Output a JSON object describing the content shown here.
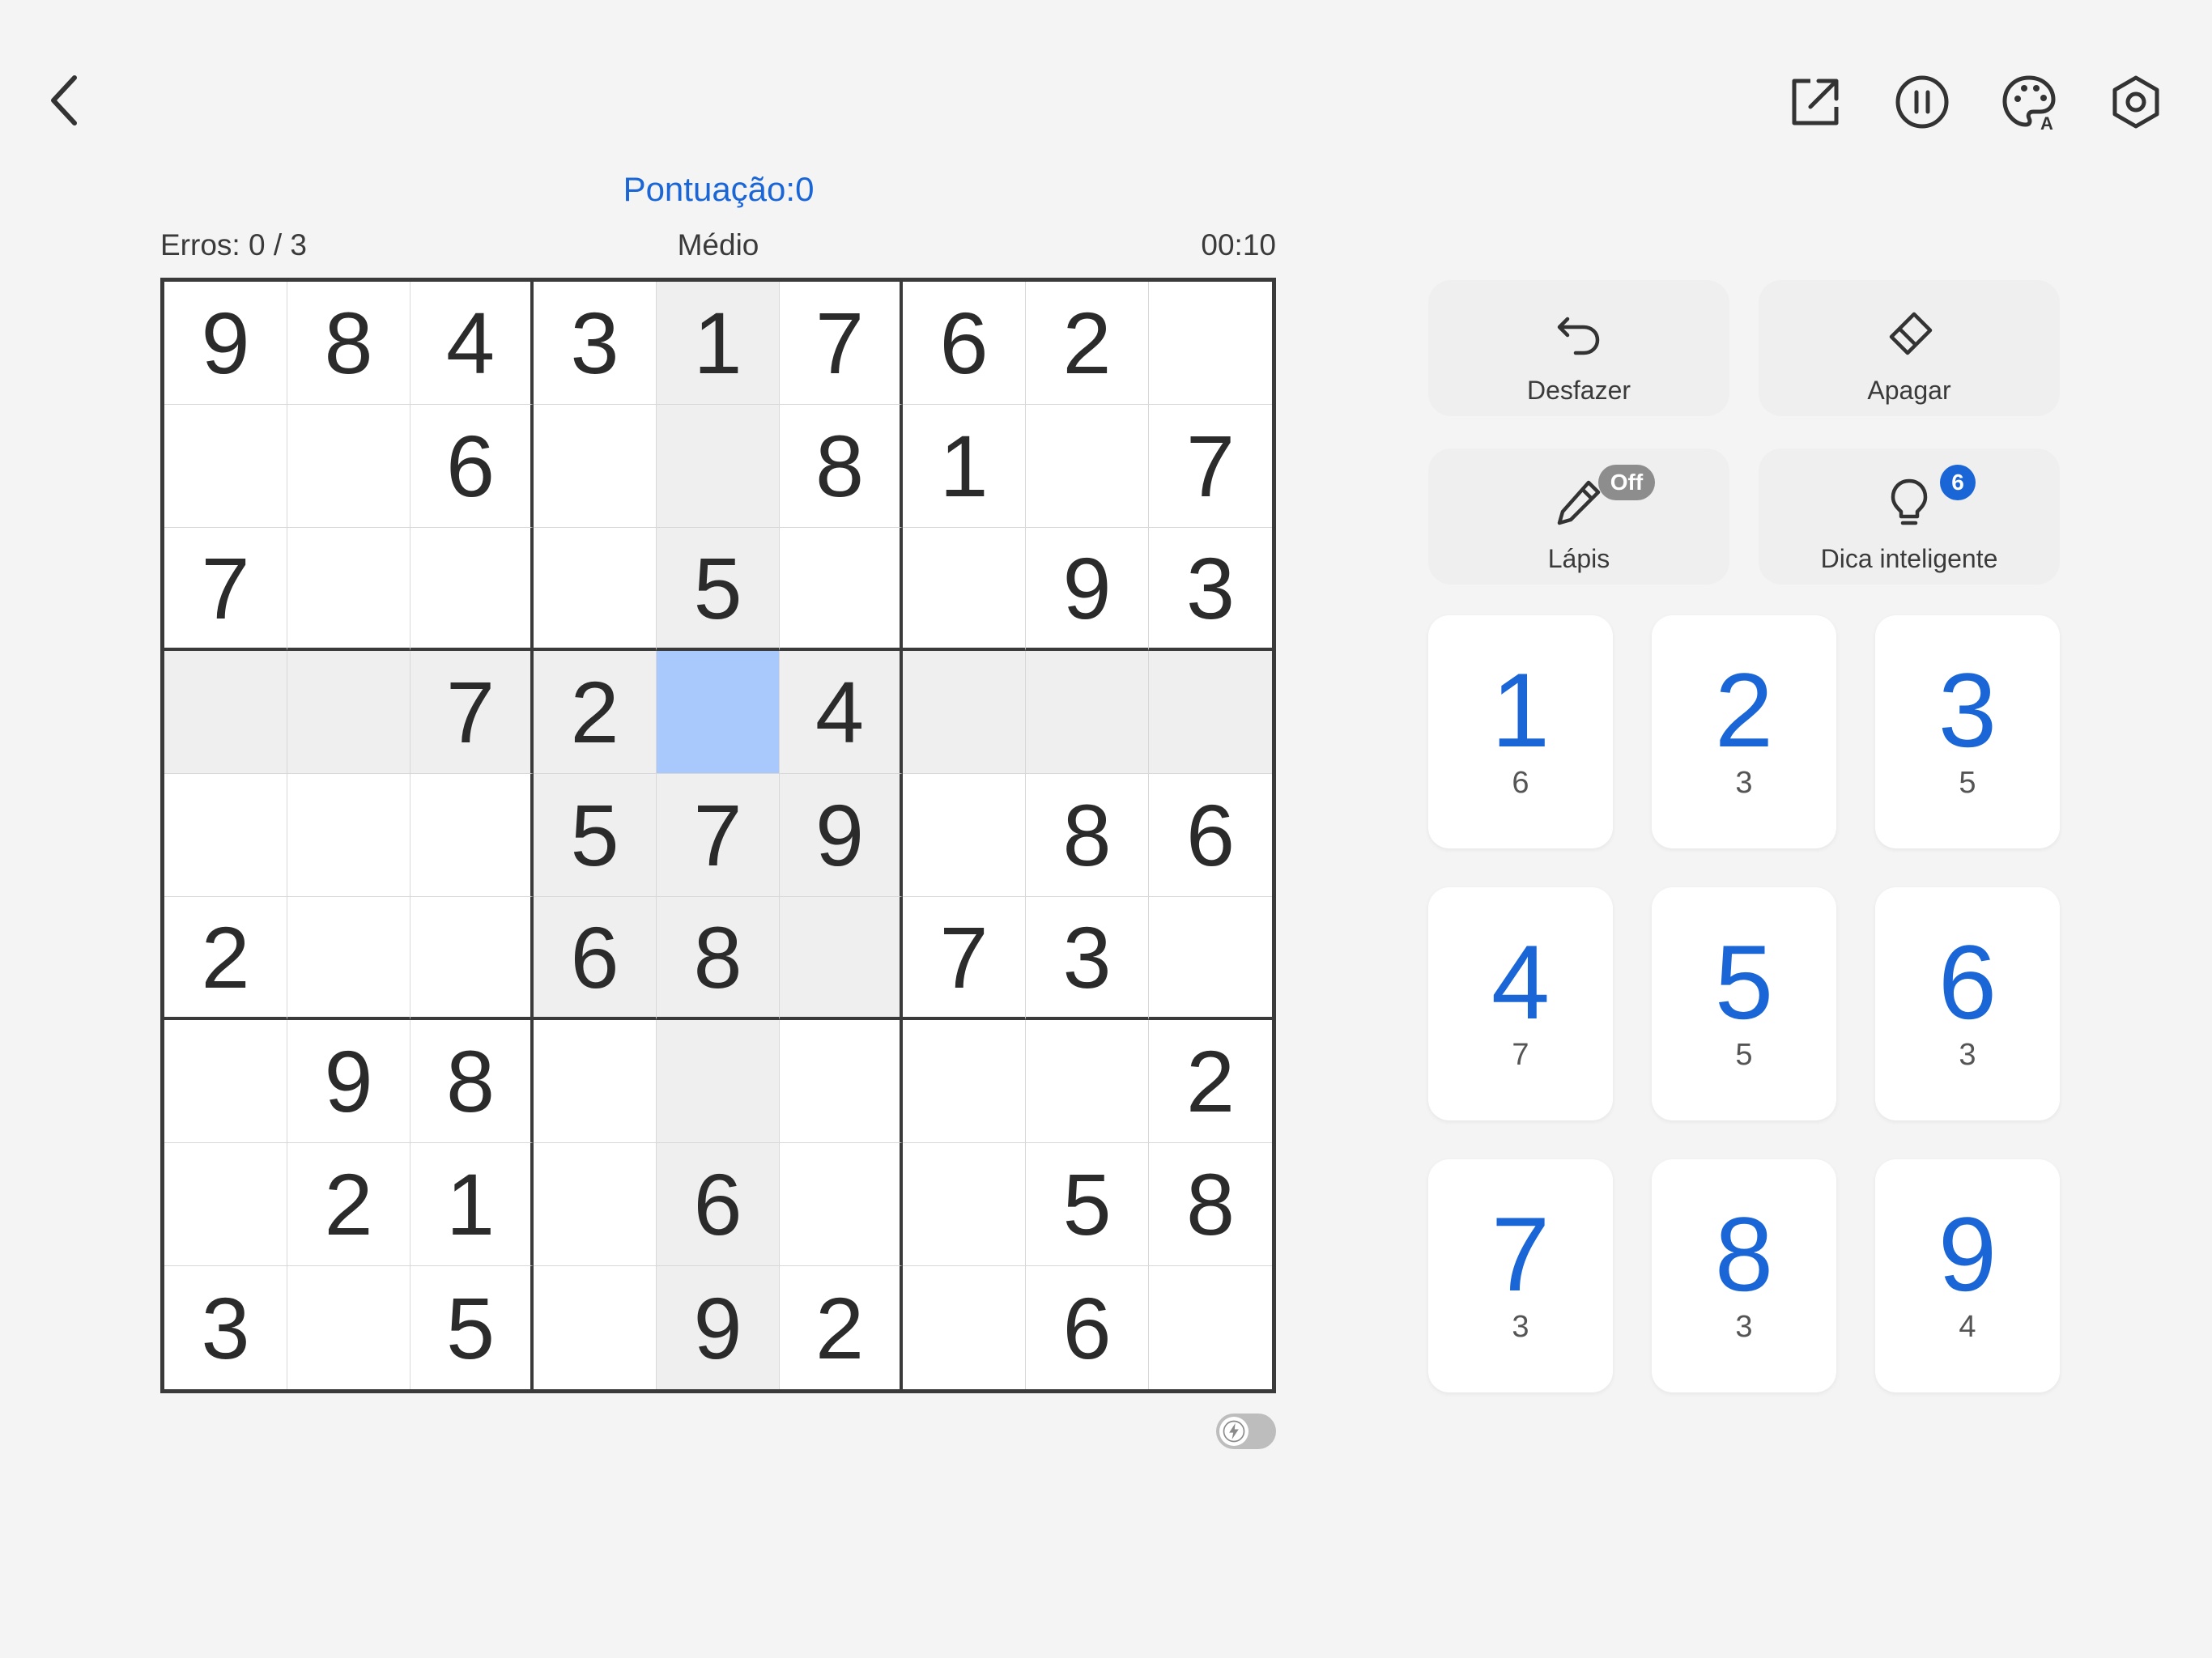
{
  "header": {
    "score_label": "Pontuação:0",
    "errors_label": "Erros: 0 / 3",
    "difficulty": "Médio",
    "timer": "00:10",
    "icons": [
      "back-icon",
      "share-icon",
      "pause-icon",
      "theme-palette-icon",
      "settings-icon"
    ]
  },
  "board": {
    "selected": [
      3,
      4
    ],
    "rows": [
      [
        "9",
        "8",
        "4",
        "3",
        "1",
        "7",
        "6",
        "2",
        ""
      ],
      [
        "",
        "",
        "6",
        "",
        "",
        "8",
        "1",
        "",
        "7"
      ],
      [
        "7",
        "",
        "",
        "",
        "5",
        "",
        "",
        "9",
        "3"
      ],
      [
        "",
        "",
        "7",
        "2",
        "",
        "4",
        "",
        "",
        ""
      ],
      [
        "",
        "",
        "",
        "5",
        "7",
        "9",
        "",
        "8",
        "6"
      ],
      [
        "2",
        "",
        "",
        "6",
        "8",
        "",
        "7",
        "3",
        ""
      ],
      [
        "",
        "9",
        "8",
        "",
        "",
        "",
        "",
        "",
        "2"
      ],
      [
        "",
        "2",
        "1",
        "",
        "6",
        "",
        "",
        "5",
        "8"
      ],
      [
        "3",
        "",
        "5",
        "",
        "9",
        "2",
        "",
        "6",
        ""
      ]
    ]
  },
  "tools": {
    "undo_label": "Desfazer",
    "erase_label": "Apagar",
    "pencil_label": "Lápis",
    "pencil_state": "Off",
    "hint_label": "Dica inteligente",
    "hint_count": "6"
  },
  "numpad": [
    {
      "digit": "1",
      "remaining": "6"
    },
    {
      "digit": "2",
      "remaining": "3"
    },
    {
      "digit": "3",
      "remaining": "5"
    },
    {
      "digit": "4",
      "remaining": "7"
    },
    {
      "digit": "5",
      "remaining": "5"
    },
    {
      "digit": "6",
      "remaining": "3"
    },
    {
      "digit": "7",
      "remaining": "3"
    },
    {
      "digit": "8",
      "remaining": "3"
    },
    {
      "digit": "9",
      "remaining": "4"
    }
  ],
  "colors": {
    "accent": "#1a66d6",
    "selected_cell": "#a9c8fb",
    "highlight_cell": "#efefef",
    "background": "#f4f4f4"
  }
}
